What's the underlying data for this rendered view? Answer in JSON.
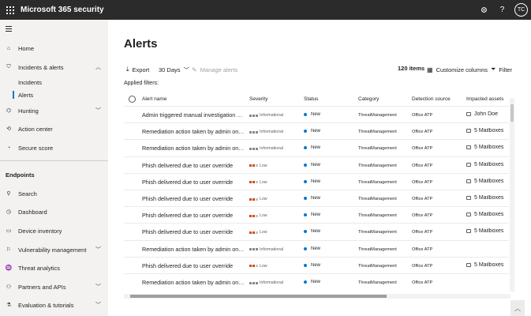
{
  "app": {
    "title": "Microsoft 365 security",
    "avatar_initials": "TC"
  },
  "topbar": {
    "settings_icon": "gear-icon",
    "help_label": "?"
  },
  "sidebar": {
    "items": [
      {
        "label": "Home",
        "icon": "home-icon"
      },
      {
        "label": "Incidents & alerts",
        "icon": "shield-icon",
        "chevron": "^"
      },
      {
        "label": "Incidents"
      },
      {
        "label": "Alerts"
      },
      {
        "label": "Hunting",
        "icon": "hunting-icon",
        "chevron": "v"
      },
      {
        "label": "Action center",
        "icon": "action-center-icon"
      },
      {
        "label": "Secure score",
        "icon": "score-icon"
      }
    ],
    "section": "Endpoints",
    "endpoints": [
      {
        "label": "Search",
        "icon": "search-icon"
      },
      {
        "label": "Dashboard",
        "icon": "dashboard-icon"
      },
      {
        "label": "Device inventory",
        "icon": "device-icon"
      },
      {
        "label": "Vulnerability management",
        "icon": "vulnerability-icon",
        "chevron": "v"
      },
      {
        "label": "Threat analytics",
        "icon": "threat-icon"
      },
      {
        "label": "Partners and APIs",
        "icon": "partners-icon",
        "chevron": "v"
      },
      {
        "label": "Evaluation & tutorials",
        "icon": "evaluation-icon",
        "chevron": "v"
      }
    ]
  },
  "main": {
    "title": "Alerts",
    "toolbar": {
      "export": "Export",
      "range": "30 Days",
      "manage": "Manage alerts",
      "count": "120 items",
      "customize": "Customize columns",
      "filter": "Filter"
    },
    "applied_filters": "Applied filters:",
    "columns": [
      "Alert name",
      "Severity",
      "Status",
      "Category",
      "Detection source",
      "Impacted assets"
    ],
    "rows": [
      {
        "name": "Admin triggered manual investigation o...",
        "severity": "Informational",
        "status": "New",
        "category": "ThreatManagement",
        "source": "Office ATP",
        "assets": "John Doe"
      },
      {
        "name": "Remediation action taken by admin on ...",
        "severity": "Informational",
        "status": "New",
        "category": "ThreatManagement",
        "source": "Office ATP",
        "assets": "5 Mailboxes"
      },
      {
        "name": "Remediation action taken by admin on ...",
        "severity": "Informational",
        "status": "New",
        "category": "ThreatManagement",
        "source": "Office ATP",
        "assets": "5 Mailboxes"
      },
      {
        "name": "Phish delivered due to user override",
        "severity": "Low",
        "status": "New",
        "category": "ThreatManagement",
        "source": "Office ATP",
        "assets": "5 Mailboxes"
      },
      {
        "name": "Phish delivered due to user override",
        "severity": "Low",
        "status": "New",
        "category": "ThreatManagement",
        "source": "Office ATP",
        "assets": "5 Mailboxes"
      },
      {
        "name": "Phish delivered due to user override",
        "severity": "Low",
        "status": "New",
        "category": "ThreatManagement",
        "source": "Office ATP",
        "assets": "5 Mailboxes"
      },
      {
        "name": "Phish delivered due to user override",
        "severity": "Low",
        "status": "New",
        "category": "ThreatManagement",
        "source": "Office ATP",
        "assets": "5 Mailboxes"
      },
      {
        "name": "Phish delivered due to user override",
        "severity": "Low",
        "status": "New",
        "category": "ThreatManagement",
        "source": "Office ATP",
        "assets": "5 Mailboxes"
      },
      {
        "name": "Remediation action taken by admin on ...",
        "severity": "Informational",
        "status": "New",
        "category": "ThreatManagement",
        "source": "Office ATP",
        "assets": ""
      },
      {
        "name": "Phish delivered due to user override",
        "severity": "Low",
        "status": "New",
        "category": "ThreatManagement",
        "source": "Office ATP",
        "assets": "5 Mailboxes"
      },
      {
        "name": "Remediation action taken by admin on ...",
        "severity": "Informational",
        "status": "New",
        "category": "ThreatManagement",
        "source": "Office ATP",
        "assets": ""
      }
    ]
  },
  "colors": {
    "topbar": "#2b2b2b",
    "accent": "#0078d4",
    "low": "#ca5010"
  }
}
